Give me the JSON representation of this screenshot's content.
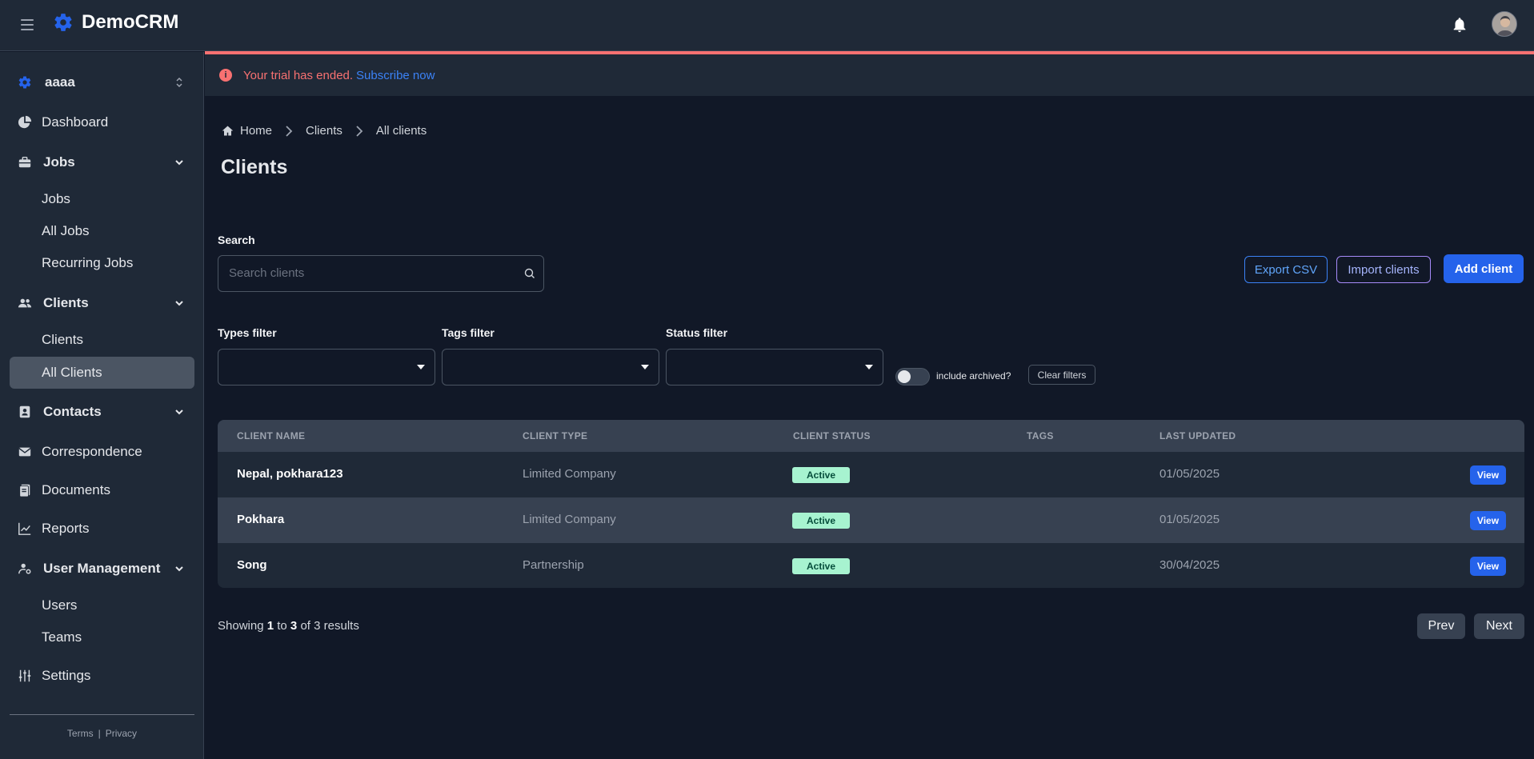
{
  "app": {
    "brand": "DemoCRM"
  },
  "colors": {
    "accent": "#2563eb",
    "alert": "#f87171",
    "active_badge": "#a7f3d0"
  },
  "sidebar": {
    "workspace": "aaaa",
    "items": {
      "dashboard": "Dashboard",
      "jobs": "Jobs",
      "jobs_sub": [
        "Jobs",
        "All Jobs",
        "Recurring Jobs"
      ],
      "clients": "Clients",
      "clients_sub": [
        "Clients",
        "All Clients"
      ],
      "contacts": "Contacts",
      "correspondence": "Correspondence",
      "documents": "Documents",
      "reports": "Reports",
      "user_management": "User Management",
      "user_management_sub": [
        "Users",
        "Teams"
      ],
      "settings": "Settings"
    },
    "footer": {
      "terms": "Terms",
      "separator": "|",
      "privacy": "Privacy"
    }
  },
  "trial_banner": {
    "message": "Your trial has ended.",
    "link": "Subscribe now"
  },
  "breadcrumb": [
    "Home",
    "Clients",
    "All clients"
  ],
  "page_title": "Clients",
  "search": {
    "label": "Search",
    "placeholder": "Search clients",
    "value": ""
  },
  "actions": {
    "export": "Export CSV",
    "import": "Import clients",
    "add": "Add client"
  },
  "filters": {
    "types": {
      "label": "Types filter",
      "value": ""
    },
    "tags": {
      "label": "Tags filter",
      "value": ""
    },
    "status": {
      "label": "Status filter",
      "value": ""
    },
    "archived_label": "include archived?",
    "archived_on": false,
    "clear": "Clear filters"
  },
  "table": {
    "headers": [
      "CLIENT NAME",
      "CLIENT TYPE",
      "CLIENT STATUS",
      "TAGS",
      "LAST UPDATED"
    ],
    "rows": [
      {
        "name": "Nepal, pokhara123",
        "type": "Limited Company",
        "status": "Active",
        "tags": "",
        "updated": "01/05/2025",
        "action": "View"
      },
      {
        "name": "Pokhara",
        "type": "Limited Company",
        "status": "Active",
        "tags": "",
        "updated": "01/05/2025",
        "action": "View"
      },
      {
        "name": "Song",
        "type": "Partnership",
        "status": "Active",
        "tags": "",
        "updated": "30/04/2025",
        "action": "View"
      }
    ]
  },
  "pagination": {
    "prefix": "Showing",
    "from": "1",
    "to_word": "to",
    "to": "3",
    "of_word": "of",
    "total": "3",
    "suffix": "results",
    "prev": "Prev",
    "next": "Next"
  }
}
